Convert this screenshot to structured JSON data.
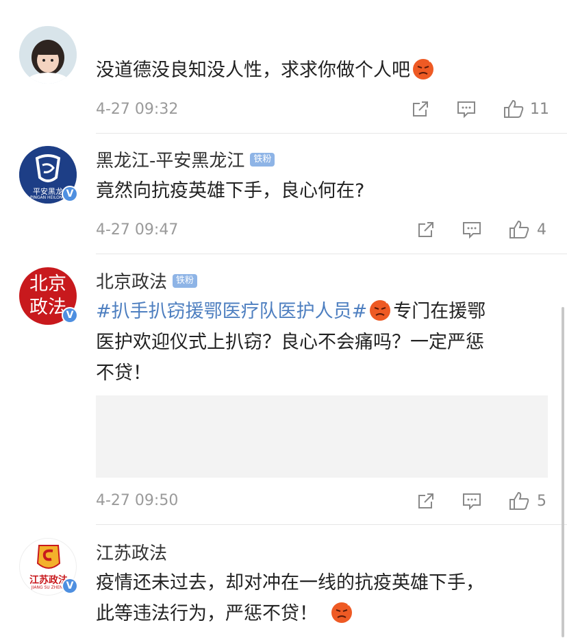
{
  "comments": [
    {
      "name": "",
      "text": "没道德没良知没人性，求求你做个人吧",
      "time": "4-27 09:32",
      "likes": "11",
      "avatar_icon": "girl-photo-avatar"
    },
    {
      "name": "黑龙江-平安黑龙江",
      "badge": "铁粉",
      "avatar_text": "平安黑龙",
      "avatar_sub": "PINGAN HEILONG",
      "text": "竟然向抗疫英雄下手，良心何在?",
      "time": "4-27 09:47",
      "likes": "4",
      "verified": "V"
    },
    {
      "name": "北京政法",
      "badge": "铁粉",
      "avatar_text": "北京政法",
      "topic": "#扒手扒窃援鄂医疗队医护人员#",
      "text_after_emoji": "专门在援鄂",
      "text_line2": "医护欢迎仪式上扒窃？良心不会痛吗？一定严惩",
      "text_line3": "不贷！",
      "time": "4-27 09:50",
      "likes": "5",
      "verified": "V"
    },
    {
      "name": "江苏政法",
      "avatar_text": "江苏政法",
      "avatar_sub": "JIANG SU ZHENG",
      "text_line1": "疫情还未过去，却对冲在一线的抗疫英雄下手，",
      "text_line2": "此等违法行为，严惩不贷！",
      "verified": "V"
    }
  ],
  "colors": {
    "accent": "#4e7fc0",
    "verified": "#4e8fe0",
    "badge": "#8eb4e6",
    "beijing_red": "#c8191d"
  }
}
